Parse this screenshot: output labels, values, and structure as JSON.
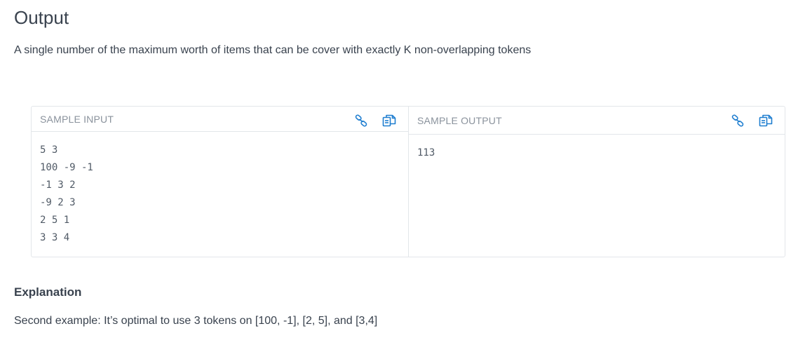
{
  "output_section": {
    "title": "Output",
    "description": "A single number of the maximum worth of items that can be cover with exactly K non-overlapping tokens"
  },
  "sample_input": {
    "label": "SAMPLE INPUT",
    "content": "5 3\n100 -9 -1\n-1 3 2\n-9 2 3\n2 5 1\n3 3 4",
    "link_icon": "link-icon",
    "copy_icon": "copy-icon"
  },
  "sample_output": {
    "label": "SAMPLE OUTPUT",
    "content": "113",
    "link_icon": "link-icon",
    "copy_icon": "copy-icon"
  },
  "explanation": {
    "title": "Explanation",
    "text": "Second example: It’s optimal to use 3 tokens on [100, -1], [2, 5], and [3,4]"
  },
  "colors": {
    "icon": "#1f7ed0",
    "border": "#e3e6ea",
    "label": "#8a929c",
    "text": "#39424e"
  }
}
